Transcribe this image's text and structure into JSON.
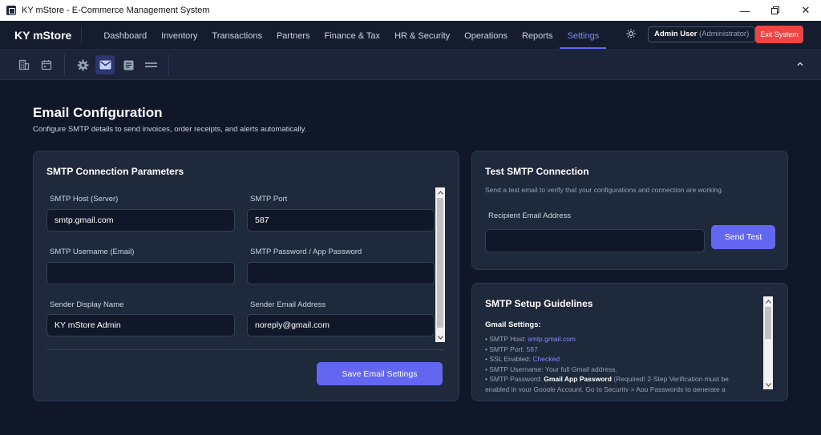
{
  "window": {
    "title": "KY mStore - E-Commerce Management System"
  },
  "topnav": {
    "brand": "KY mStore",
    "items": [
      "Dashboard",
      "Inventory",
      "Transactions",
      "Partners",
      "Finance & Tax",
      "HR & Security",
      "Operations",
      "Reports",
      "Settings"
    ],
    "active": "Settings",
    "user_name": "Admin User",
    "user_role": "(Administrator)",
    "exit_label": "Exit System"
  },
  "page": {
    "title": "Email Configuration",
    "subtitle": "Configure SMTP details to send invoices, order receipts, and alerts automatically."
  },
  "smtp": {
    "title": "SMTP Connection Parameters",
    "host_label": "SMTP Host (Server)",
    "host_value": "smtp.gmail.com",
    "port_label": "SMTP Port",
    "port_value": "587",
    "username_label": "SMTP Username (Email)",
    "username_value": "",
    "password_label": "SMTP Password / App Password",
    "password_value": "",
    "sender_name_label": "Sender Display Name",
    "sender_name_value": "KY mStore Admin",
    "sender_email_label": "Sender Email Address",
    "sender_email_value": "noreply@gmail.com",
    "save_label": "Save Email Settings"
  },
  "test": {
    "title": "Test SMTP Connection",
    "description": "Send a test email to verify that your configurations and connection are working.",
    "recipient_label": "Recipient Email Address",
    "recipient_value": "",
    "send_label": "Send Test"
  },
  "guidelines": {
    "title": "SMTP Setup Guidelines",
    "section_title": "Gmail Settings:",
    "host_prefix": "• SMTP Host: ",
    "host_value": "smtp.gmail.com",
    "port_prefix": "• SMTP Port: ",
    "port_value": "587",
    "ssl_prefix": "• SSL Enabled: ",
    "ssl_value": "Checked",
    "username_line": "• SMTP Username: Your full Gmail address.",
    "password_prefix": "• SMTP Password: ",
    "password_strong": "Gmail App Password",
    "password_rest": " (Required! 2-Step Verification must be",
    "password_cont": "enabled in your Google Account. Go to Security > App Passwords to generate a"
  },
  "colors": {
    "accent": "#6366f1",
    "danger": "#ef4444",
    "background": "#0f1729",
    "card": "#1e293b"
  }
}
